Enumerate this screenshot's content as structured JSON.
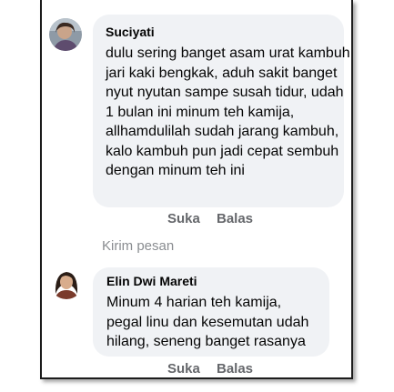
{
  "comments": [
    {
      "author": "Suciyati",
      "lines": [
        "dulu sering banget asam urat kambuh,",
        "jari kaki bengkak, aduh sakit banget",
        "nyut nyutan sampe susah tidur, udah",
        "1 bulan ini minum teh kamija,",
        "allhamdulilah sudah jarang kambuh,",
        "kalo kambuh pun jadi cepat sembuh",
        "dengan minum teh ini"
      ],
      "like_label": "Suka",
      "reply_label": "Balas"
    },
    {
      "author": "Elin Dwi Mareti",
      "lines": [
        "Minum 4 harian teh kamija,",
        "pegal linu dan kesemutan udah",
        "hilang, seneng banget rasanya"
      ],
      "like_label": "Suka",
      "reply_label": "Balas"
    }
  ],
  "send_message_label": "Kirim pesan"
}
